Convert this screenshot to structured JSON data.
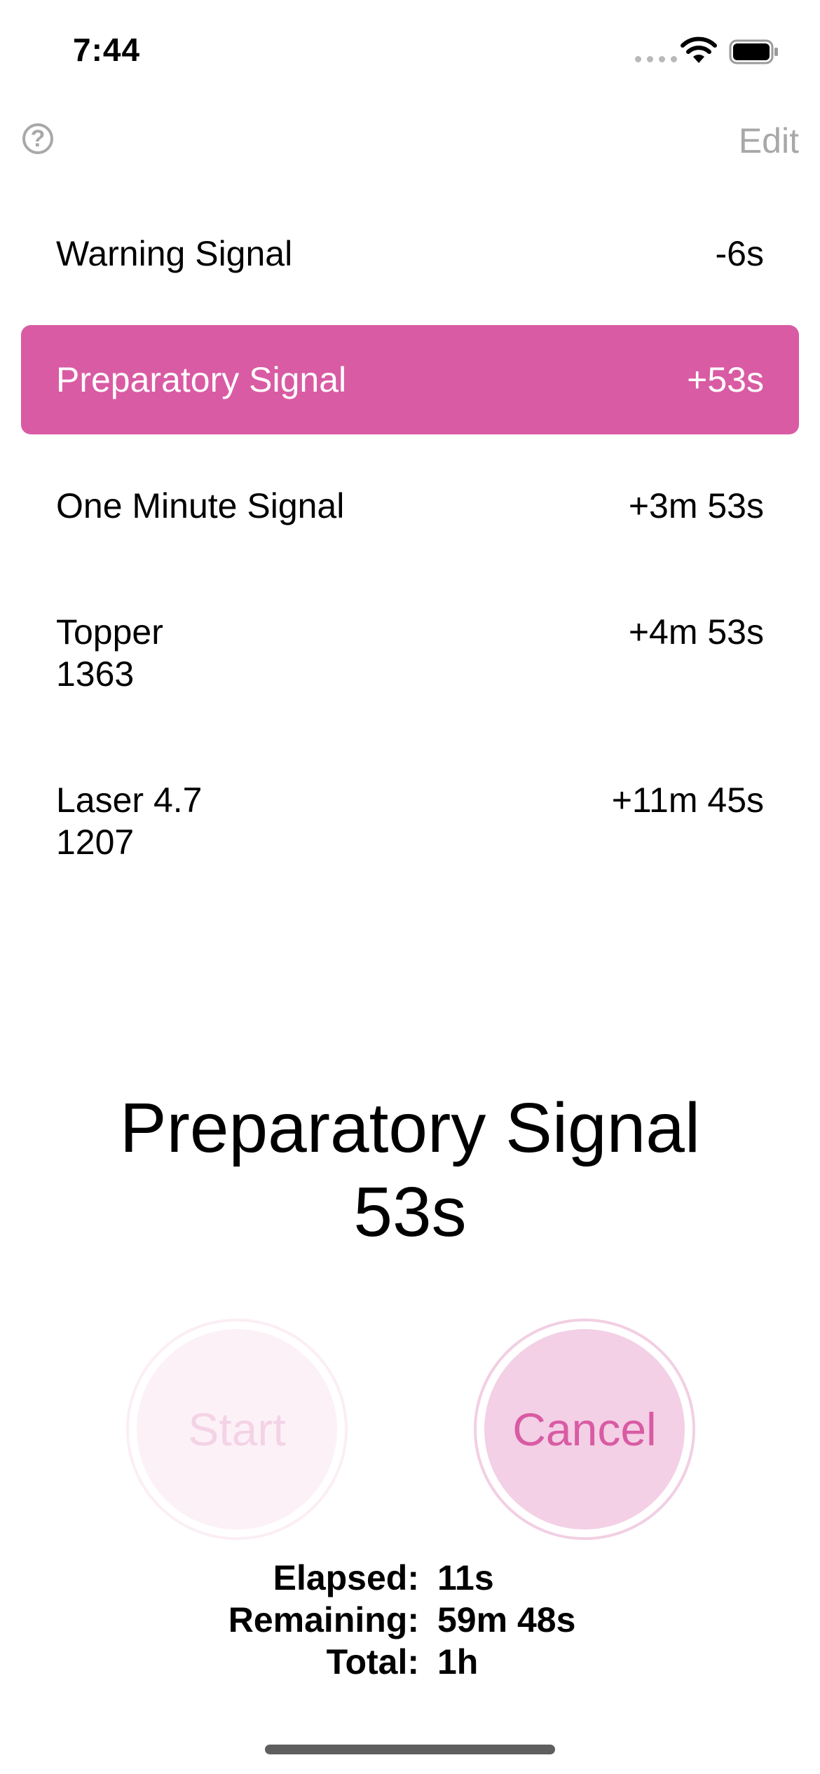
{
  "status_bar": {
    "time": "7:44"
  },
  "nav": {
    "help_symbol": "?",
    "edit_label": "Edit"
  },
  "signals": [
    {
      "name": "Warning Signal",
      "sub": "",
      "offset": "-6s",
      "active": false
    },
    {
      "name": "Preparatory Signal",
      "sub": "",
      "offset": "+53s",
      "active": true
    },
    {
      "name": "One Minute Signal",
      "sub": "",
      "offset": "+3m 53s",
      "active": false
    },
    {
      "name": "Topper",
      "sub": "1363",
      "offset": "+4m 53s",
      "active": false
    },
    {
      "name": "Laser 4.7",
      "sub": "1207",
      "offset": "+11m 45s",
      "active": false
    }
  ],
  "current": {
    "name": "Preparatory Signal",
    "countdown": "53s"
  },
  "buttons": {
    "start_label": "Start",
    "cancel_label": "Cancel"
  },
  "stats": {
    "elapsed_label": "Elapsed:",
    "elapsed_value": "11s",
    "remaining_label": "Remaining:",
    "remaining_value": "59m 48s",
    "total_label": "Total:",
    "total_value": "1h"
  },
  "colors": {
    "accent": "#d95ba4",
    "cancel_fill": "#f3d0e5",
    "start_fill_disabled": "#fcf1f7",
    "muted_gray": "#a8a8a8"
  },
  "icons": [
    "cellular-signal-icon",
    "wifi-icon",
    "battery-icon",
    "help-icon"
  ]
}
